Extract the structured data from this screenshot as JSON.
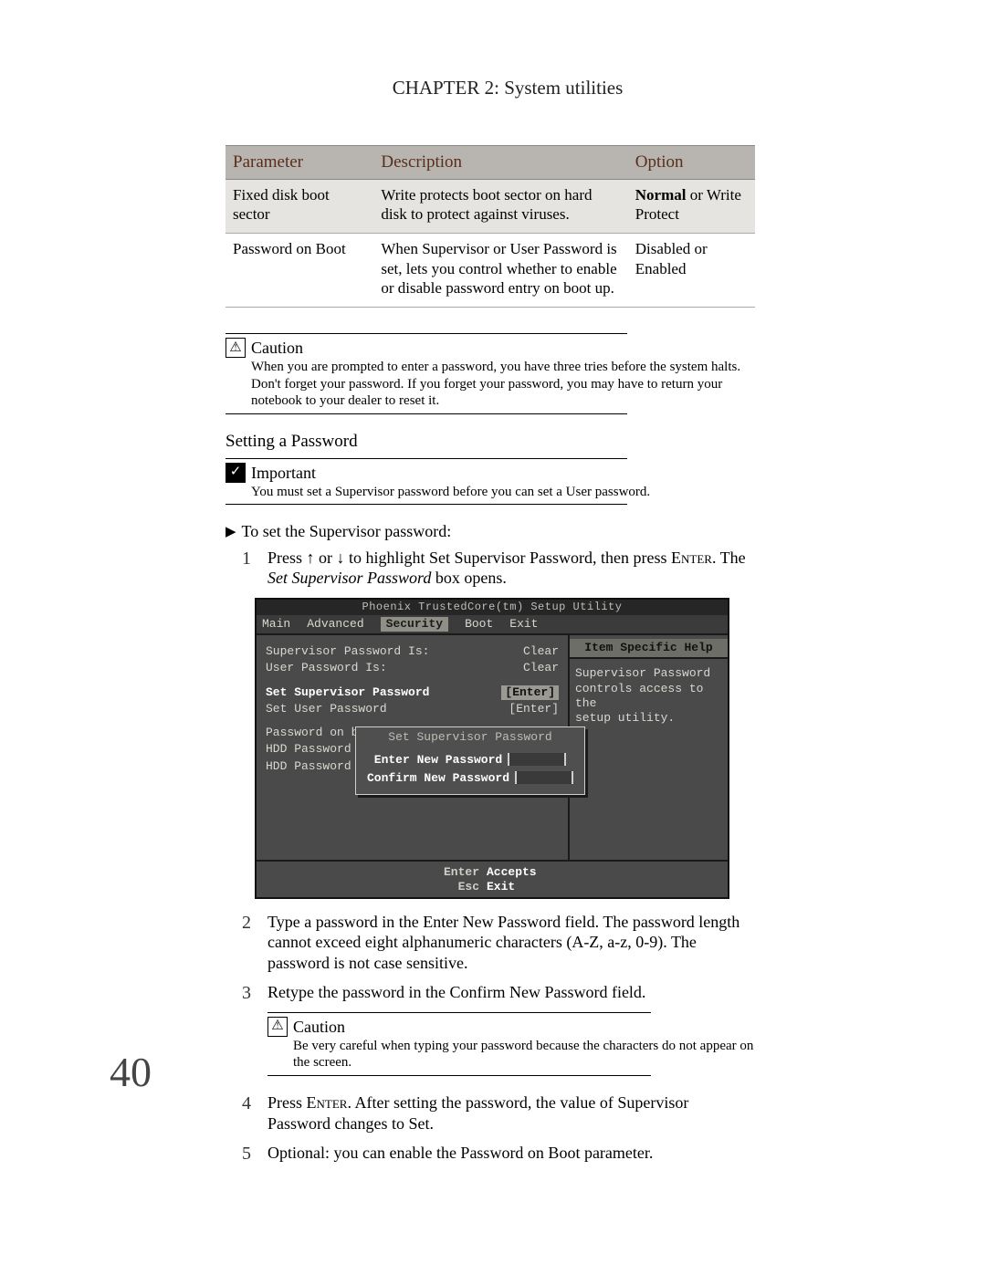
{
  "header": "CHAPTER 2: System utilities",
  "table": {
    "headers": {
      "param": "Parameter",
      "desc": "Description",
      "opt": "Option"
    },
    "rows": [
      {
        "param": "Fixed disk boot sector",
        "desc": "Write protects boot sector on hard disk to protect against viruses.",
        "opt_bold": "Normal",
        "opt_tail": " or Write Protect"
      },
      {
        "param": "Password on Boot",
        "desc": "When Supervisor or User Password is set, lets you control whether to enable or disable password entry on boot up.",
        "opt_bold": "",
        "opt_tail": "Disabled or Enabled"
      }
    ]
  },
  "caution1": {
    "title": "Caution",
    "text": "When you are prompted to enter a password, you have three tries before the system halts. Don't forget your password. If you forget your password, you may have to return your notebook to your dealer to reset it."
  },
  "section": "Setting a Password",
  "important": {
    "title": "Important",
    "text": "You must set a Supervisor password before you can set a User password."
  },
  "lead": "To set the Supervisor password:",
  "steps": {
    "s1a": "Press ",
    "s1b": " or ",
    "s1c": " to highlight Set Supervisor Password, then press ",
    "s1_enter": "Enter",
    "s1d": ". The ",
    "s1_em": "Set Supervisor Password",
    "s1e": " box opens.",
    "s2": "Type a password in the Enter New Password field. The password length cannot exceed eight alphanumeric characters (A-Z, a-z, 0-9). The password is not case sensitive.",
    "s3": "Retype the password in the Confirm New Password field.",
    "s4a": "Press ",
    "s4_enter": "Enter",
    "s4b": ". After setting the password, the value of Supervisor Password changes to Set.",
    "s5": "Optional: you can enable the Password on Boot parameter."
  },
  "caution2": {
    "title": "Caution",
    "text": "Be very careful when typing your password because the characters do not appear on the screen."
  },
  "bios": {
    "title": "Phoenix TrustedCore(tm) Setup Utility",
    "menu": {
      "main": "Main",
      "adv": "Advanced",
      "sec": "Security",
      "boot": "Boot",
      "exit": "Exit"
    },
    "help_hd": "Item Specific Help",
    "help1": "Supervisor Password",
    "help2": "controls access to the",
    "help3": "setup utility.",
    "r1l": "Supervisor Password Is:",
    "r1v": "Clear",
    "r2l": "User Password Is:",
    "r2v": "Clear",
    "r3l": "Set Supervisor Password",
    "r3v": "[Enter]",
    "r4l": "Set User Password",
    "r4v": "[Enter]",
    "r5l": "Password on boot",
    "r6l": "HDD Password",
    "r7l": "HDD Password",
    "dlg_title": "Set Supervisor Password",
    "dlg_r1": "Enter New Password",
    "dlg_r2": "Confirm New Password",
    "fk1": "Enter",
    "fa1": "Accepts",
    "fk2": "Esc",
    "fa2": "Exit"
  },
  "page_number": "40"
}
